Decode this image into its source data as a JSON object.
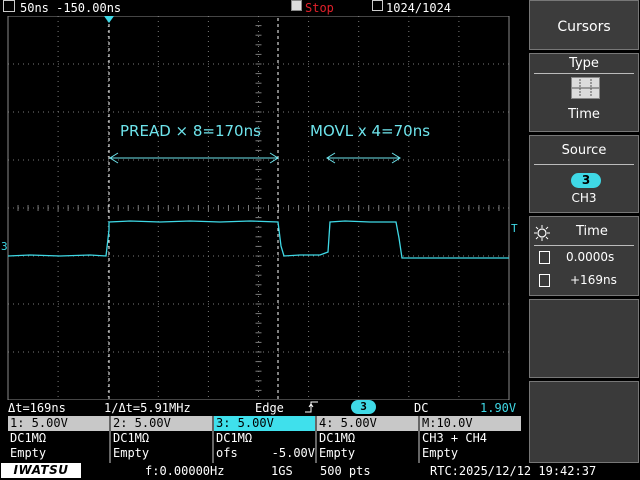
{
  "top_bar": {
    "timebase": "50ns -150.00ns",
    "run_state": "Stop",
    "memory": "1024/1024"
  },
  "scope": {
    "channel_marker": "3",
    "trigger_marker": "T",
    "annotation_1": "PREAD × 8=170ns",
    "annotation_2": "MOVL x 4=70ns",
    "trace_color": "#3fd9e6",
    "cursor_color": "#ffffff",
    "grid_color": "#7a7a7a"
  },
  "readout": {
    "delta_t": "Δt=169ns",
    "inv_delta_t": "1/Δt=5.91MHz",
    "trigger_type": "Edge",
    "trigger_channel": "3",
    "coupling": "DC",
    "level": "1.90V"
  },
  "channels": [
    {
      "header": "1: 5.00V",
      "line1": "DC1MΩ",
      "line2": "Empty",
      "line2_right": ""
    },
    {
      "header": "2: 5.00V",
      "line1": "DC1MΩ",
      "line2": "Empty",
      "line2_right": ""
    },
    {
      "header": "3: 5.00V",
      "line1": "DC1MΩ",
      "line2": "ofs",
      "line2_right": "-5.00V"
    },
    {
      "header": "4: 5.00V",
      "line1": "DC1MΩ",
      "line2": "Empty",
      "line2_right": ""
    },
    {
      "header": "M:10.0V",
      "line1": "CH3 + CH4",
      "line2": "Empty",
      "line2_right": ""
    }
  ],
  "bottom_bar": {
    "brand": "IWATSU",
    "frequency": "f:0.00000Hz",
    "sample_rate": "1GS",
    "points": "500 pts",
    "rtc": "RTC:2025/12/12 19:42:37"
  },
  "menu": {
    "title": "Cursors",
    "type_label": "Type",
    "type_value": "Time",
    "source_label": "Source",
    "source_channel": "3",
    "source_value": "CH3",
    "time_label": "Time",
    "cursor1_value": "0.0000s",
    "cursor2_value": "+169ns"
  }
}
